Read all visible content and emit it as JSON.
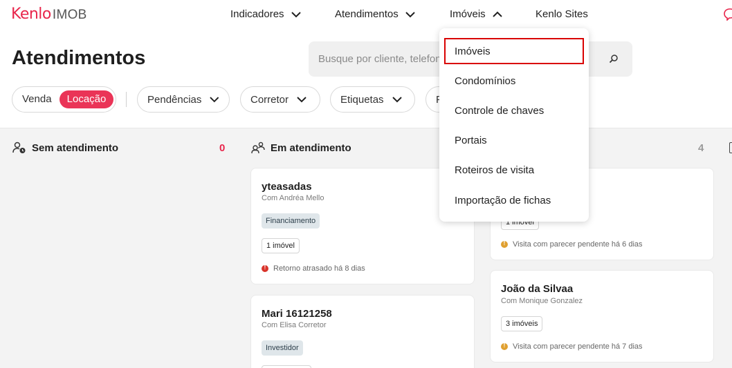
{
  "brand": {
    "name": "Kenlo",
    "product": "IMOB"
  },
  "nav": [
    {
      "label": "Indicadores",
      "chevron": "down"
    },
    {
      "label": "Atendimentos",
      "chevron": "down"
    },
    {
      "label": "Imóveis",
      "chevron": "up"
    },
    {
      "label": "Kenlo Sites"
    }
  ],
  "page": {
    "title": "Atendimentos"
  },
  "search": {
    "placeholder": "Busque por cliente, telefone"
  },
  "filters": {
    "segment": {
      "options": [
        "Venda",
        "Locação"
      ],
      "selected": "Locação"
    },
    "pills": [
      "Pendências",
      "Corretor",
      "Etiquetas",
      "F"
    ]
  },
  "columns": [
    {
      "title": "Sem atendimento",
      "count": "0",
      "icon": "user-clock-icon"
    },
    {
      "title": "Em atendimento",
      "icon": "users-icon"
    },
    {
      "count": "4"
    }
  ],
  "cards": [
    {
      "name": "yteasadas",
      "sub": "Com Andréa Mello",
      "tag": "Financiamento",
      "badge": "1 imóvel",
      "status": "Retorno atrasado há 8 dias",
      "status_color": "#d9342b"
    },
    {
      "name": "Mari 16121258",
      "sub": "Com Elisa Corretor",
      "tag": "Investidor"
    },
    {
      "badge": "1 imóvel",
      "status": "Visita com parecer pendente há 6 dias",
      "status_color": "#e0a030"
    },
    {
      "name": "João da Silvaa",
      "sub": "Com Monique Gonzalez",
      "badge": "3 imóveis",
      "status": "Visita com parecer pendente há 7 dias",
      "status_color": "#e0a030"
    }
  ],
  "dropdown": {
    "items": [
      "Imóveis",
      "Condomínios",
      "Controle de chaves",
      "Portais",
      "Roteiros de visita",
      "Importação de fichas"
    ],
    "highlighted": "Imóveis"
  },
  "colors": {
    "accent": "#e8254b",
    "highlight_border": "#d90000"
  }
}
